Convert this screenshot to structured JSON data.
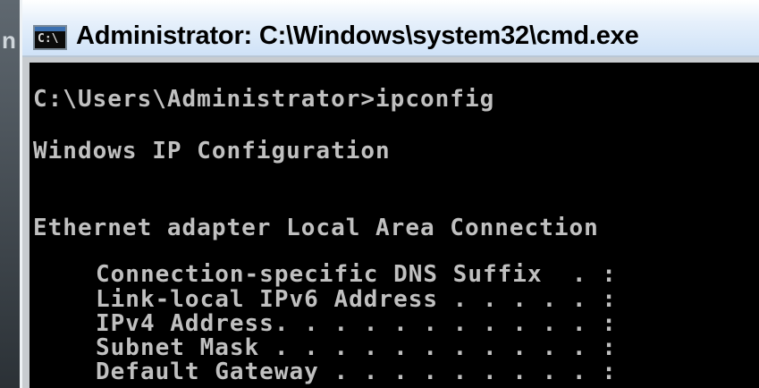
{
  "background": {
    "fragment": "n"
  },
  "window": {
    "title": "Administrator: C:\\Windows\\system32\\cmd.exe",
    "icon_name": "cmd-icon",
    "icon_glyph": "C:\\"
  },
  "console": {
    "prompt_line": "C:\\Users\\Administrator>ipconfig",
    "header": "Windows IP Configuration",
    "adapter": "Ethernet adapter Local Area Connection",
    "fields": [
      "Connection-specific DNS Suffix  . :",
      "Link-local IPv6 Address . . . . . :",
      "IPv4 Address. . . . . . . . . . . :",
      "Subnet Mask . . . . . . . . . . . :",
      "Default Gateway . . . . . . . . . :"
    ]
  }
}
